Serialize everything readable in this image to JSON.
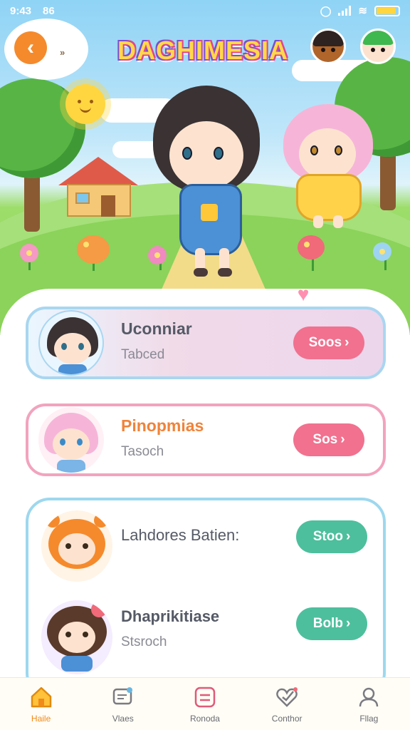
{
  "status_bar": {
    "time": "9:43",
    "extra": "86"
  },
  "header": {
    "title": "DAGHIMESIA",
    "back_extra": "»"
  },
  "list": [
    {
      "name": "Uconniar",
      "subtitle": "Tabced",
      "button_label": "Soos",
      "border_color": "#a9d6f0",
      "button_color": "#f1718f"
    },
    {
      "name": "Pinopmias",
      "subtitle": "Tasoch",
      "button_label": "Sos",
      "border_color": "#f2a3bd",
      "button_color": "#f1718f",
      "name_color": "#f0833a"
    },
    {
      "name": "Lahdores Batien:",
      "subtitle": "",
      "button_label": "Stoo",
      "button_color": "#4dbf9c"
    },
    {
      "name": "Dhaprikitiase",
      "subtitle": "Stsroch",
      "button_label": "Bolb",
      "button_color": "#4dbf9c"
    }
  ],
  "nav": [
    {
      "label": "Haile",
      "icon": "home-icon",
      "active": true
    },
    {
      "label": "Vlaes",
      "icon": "chat-icon",
      "active": false
    },
    {
      "label": "Ronoda",
      "icon": "list-icon",
      "active": false
    },
    {
      "label": "Conthor",
      "icon": "heart-check-icon",
      "active": false
    },
    {
      "label": "Fllag",
      "icon": "profile-icon",
      "active": false
    }
  ],
  "colors": {
    "accent": "#f58a2c",
    "pink": "#f1718f",
    "teal": "#4dbf9c"
  }
}
